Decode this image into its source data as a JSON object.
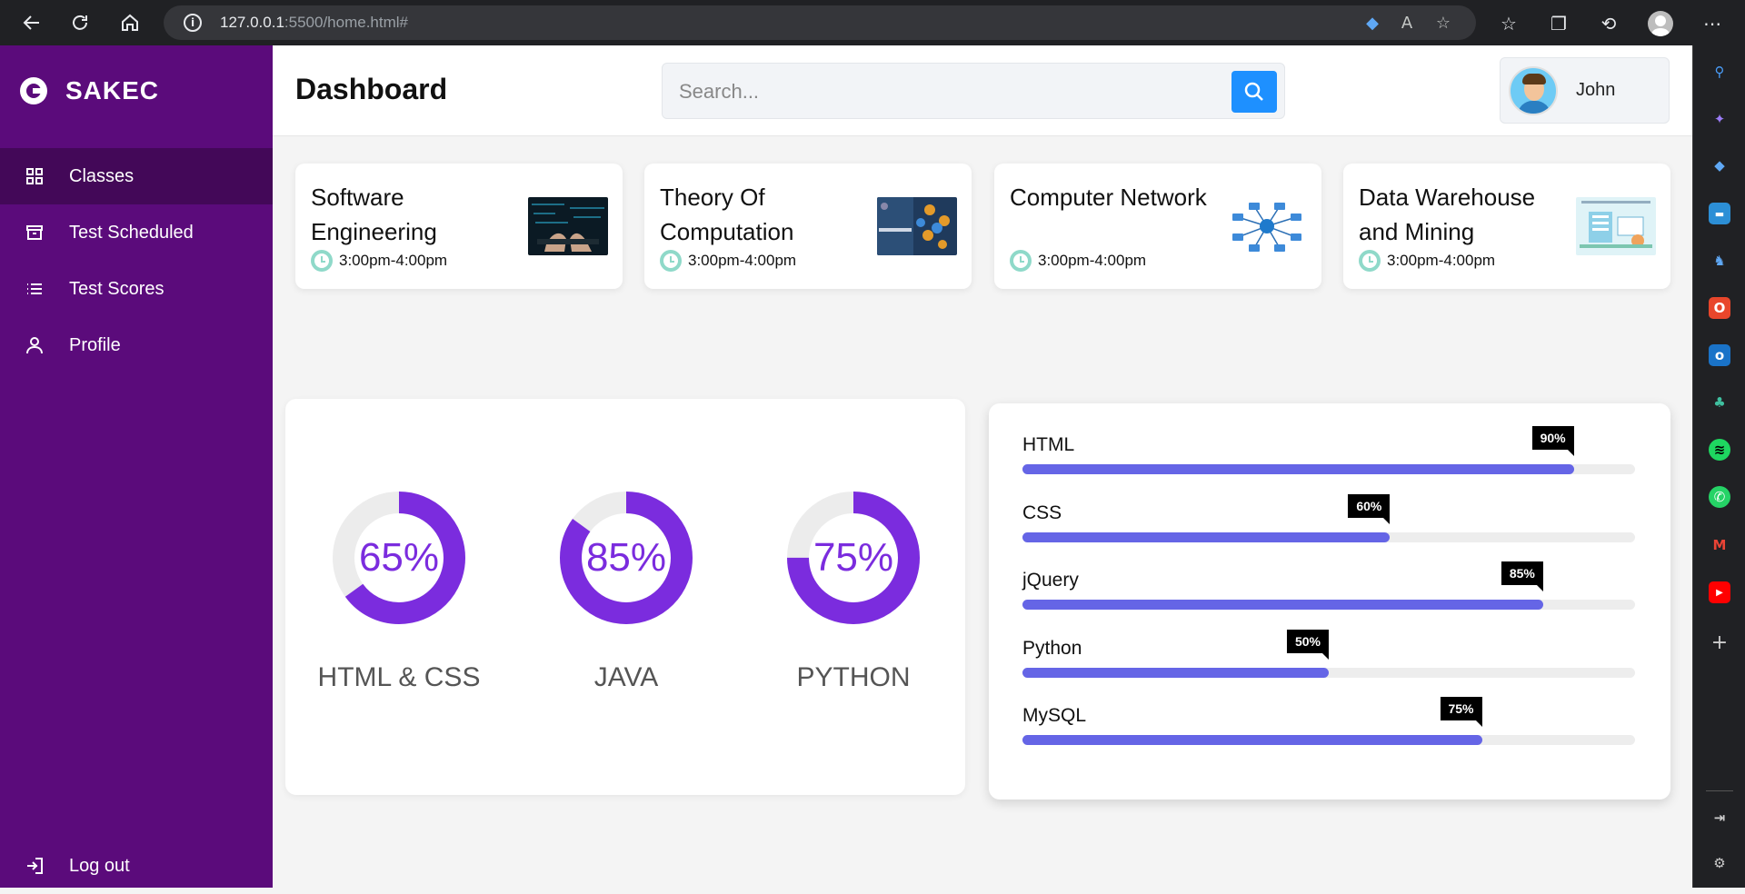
{
  "browser": {
    "url_host": "127.0.0.1",
    "url_rest": ":5500/home.html#",
    "icons": [
      "back-icon",
      "reload-icon",
      "home-icon",
      "info-icon",
      "tag-icon",
      "read-aloud-icon",
      "favorite-add-icon",
      "favorites-icon",
      "collections-icon",
      "history-icon",
      "profile-icon",
      "more-icon"
    ]
  },
  "sidebar": {
    "brand": "SAKEC",
    "items": [
      {
        "label": "Classes",
        "icon": "grid-icon",
        "active": true
      },
      {
        "label": "Test Scheduled",
        "icon": "archive-icon",
        "active": false
      },
      {
        "label": "Test Scores",
        "icon": "list-icon",
        "active": false
      },
      {
        "label": "Profile",
        "icon": "user-icon",
        "active": false
      }
    ],
    "logout": {
      "label": "Log out",
      "icon": "logout-icon"
    }
  },
  "header": {
    "title": "Dashboard",
    "search_placeholder": "Search...",
    "user_name": "John"
  },
  "classes": [
    {
      "title": "Software Engineering",
      "time": "3:00pm-4:00pm"
    },
    {
      "title": "Theory Of Computation",
      "time": "3:00pm-4:00pm"
    },
    {
      "title": "Computer Network",
      "time": "3:00pm-4:00pm"
    },
    {
      "title": "Data Warehouse and Mining",
      "time": "3:00pm-4:00pm"
    }
  ],
  "progress_circles": [
    {
      "label": "HTML & CSS",
      "value": 65,
      "text": "65%"
    },
    {
      "label": "JAVA",
      "value": 85,
      "text": "85%"
    },
    {
      "label": "PYTHON",
      "value": 75,
      "text": "75%"
    }
  ],
  "skills": [
    {
      "name": "HTML",
      "value": 90,
      "text": "90%"
    },
    {
      "name": "CSS",
      "value": 60,
      "text": "60%"
    },
    {
      "name": "jQuery",
      "value": 85,
      "text": "85%"
    },
    {
      "name": "Python",
      "value": 50,
      "text": "50%"
    },
    {
      "name": "MySQL",
      "value": 75,
      "text": "75%"
    }
  ],
  "colors": {
    "sidebar_bg": "#5b0b7b",
    "sidebar_active": "#430858",
    "donut": "#7b2cde",
    "donut_track": "#ececec",
    "skill_fill": "#6565e6",
    "search_button": "#1e90ff"
  },
  "edge_sidebar_icons": [
    "search-icon",
    "copilot-icon",
    "shopping-icon",
    "tools-icon",
    "games-icon",
    "office-icon",
    "outlook-icon",
    "tree-icon",
    "spotify-icon",
    "whatsapp-icon",
    "gmail-icon",
    "youtube-icon",
    "add-icon",
    "split-screen-icon",
    "settings-icon"
  ]
}
